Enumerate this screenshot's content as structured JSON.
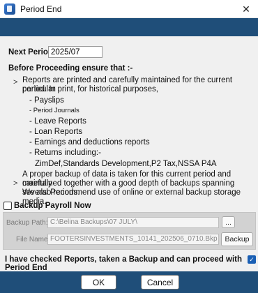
{
  "window": {
    "title": "Period End",
    "close_glyph": "✕"
  },
  "next_period": {
    "label": "Next Period",
    "value": "2025/07"
  },
  "before": {
    "heading": "Before Proceeding ensure that :-",
    "point1_line1": "Reports are printed and carefully maintained for the current period. In",
    "point1_line2": "particular print, for historical purposes,",
    "items": [
      "- Payslips",
      "- Period Journals",
      "- Leave Reports",
      "- Loan Reports",
      "- Earnings and deductions reports",
      "- Returns including:-"
    ],
    "returns_detail": "ZimDef,Standards Development,P2 Tax,NSSA P4A",
    "point2_line1": "A proper backup of data is taken for this current period and carefully",
    "point2_line2": "maintained together with a good depth of backups spanning several Periods.",
    "point2_line3": "We also recommend use of online or external backup storage media.",
    "arrow": ">"
  },
  "backup": {
    "checkbox_label": "Backup Payroll Now",
    "path_label": "Backup Path:",
    "path_value": "C:\\Belina Backups\\07 JULY\\",
    "browse_label": "...",
    "file_label": "File Name:",
    "file_value": "FOOTERSINVESTMENTS_10141_202506_0710.Bkp",
    "backup_button": "Backup"
  },
  "confirm": {
    "label": "I have checked Reports, taken a Backup and can proceed with Period End",
    "checked": true,
    "check_glyph": "✓"
  },
  "buttons": {
    "ok": "OK",
    "cancel": "Cancel"
  },
  "colors": {
    "banner": "#1f4e79",
    "check": "#1a5fb4"
  }
}
